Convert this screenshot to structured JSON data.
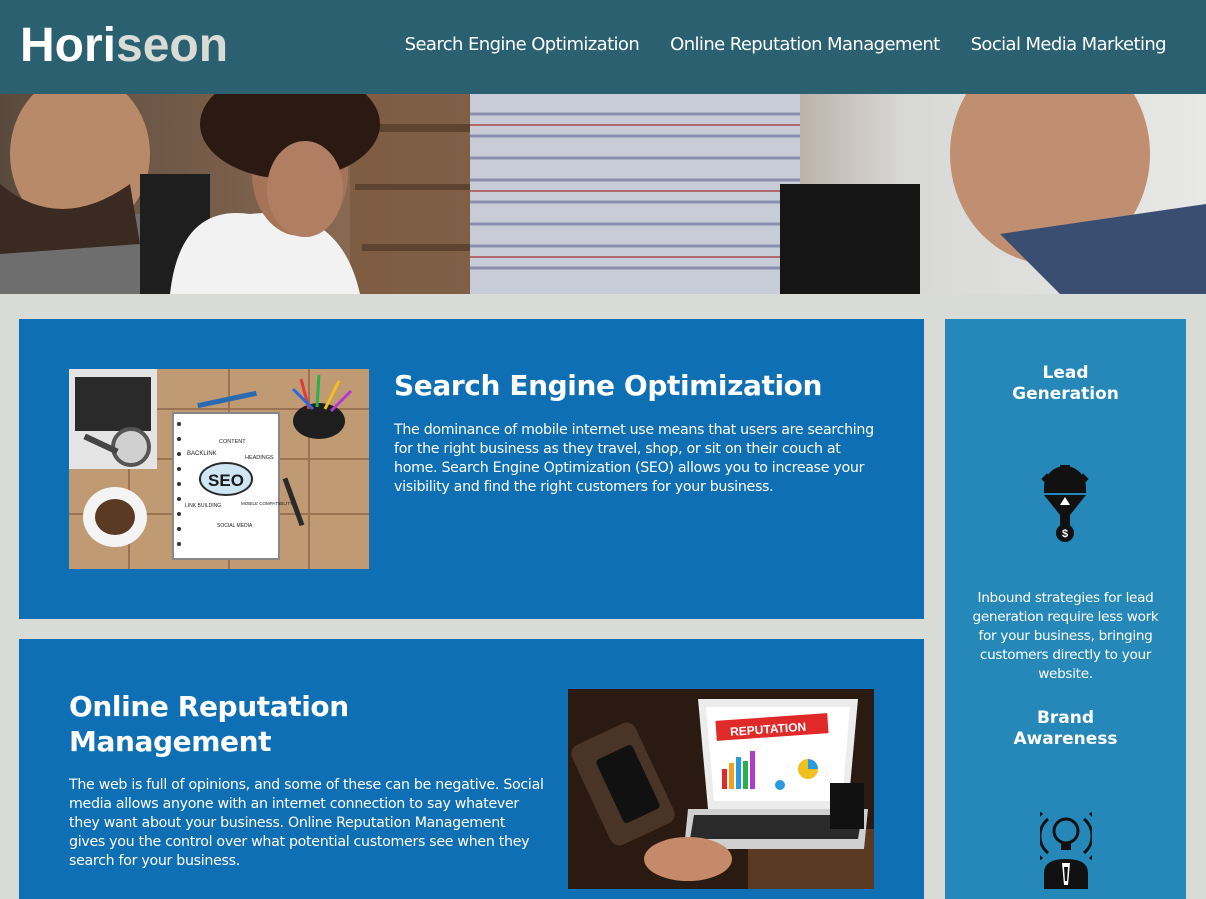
{
  "header": {
    "logo_part1": "Hori",
    "logo_part2": "seon",
    "nav": [
      {
        "label": "Search Engine Optimization"
      },
      {
        "label": "Online Reputation Management"
      },
      {
        "label": "Social Media Marketing"
      }
    ]
  },
  "hero": {
    "image": "team-meeting-photo"
  },
  "seo": {
    "title": "Search Engine Optimization",
    "text": "The dominance of mobile internet use means that users are searching for the right business as they travel, shop, or sit on their couch at home. Search Engine Optimization (SEO) allows you to increase your visibility and find the right customers for your business.",
    "image_words": {
      "seo": "SEO",
      "backlink": "BACKLINK",
      "content": "CONTENT",
      "headings": "HEADINGS",
      "link_building": "LINK BUILDING",
      "mobile": "MOBILE COMPATIBILITY",
      "social": "SOCIAL MEDIA"
    }
  },
  "orm": {
    "title": "Online Reputation Management",
    "text": "The web is full of opinions, and some of these can be negative. Social media allows anyone with an internet connection to say whatever they want about your business. Online Reputation Management gives you the control over what potential customers see when they search for your business.",
    "image_word": "REPUTATION"
  },
  "sidebar": {
    "lead_title_1": "Lead",
    "lead_title_2": "Generation",
    "lead_icon": "lead-funnel-icon",
    "lead_text": "Inbound strategies for lead generation require less work for your business, bringing customers directly to your website.",
    "brand_title_1": "Brand",
    "brand_title_2": "Awareness",
    "brand_icon": "lightbulb-person-icon"
  },
  "colors": {
    "header_bg": "#2a6070",
    "page_bg": "#d9dcd6",
    "card_bg": "#0f6fb5",
    "sidebar_bg": "#2588b8"
  }
}
